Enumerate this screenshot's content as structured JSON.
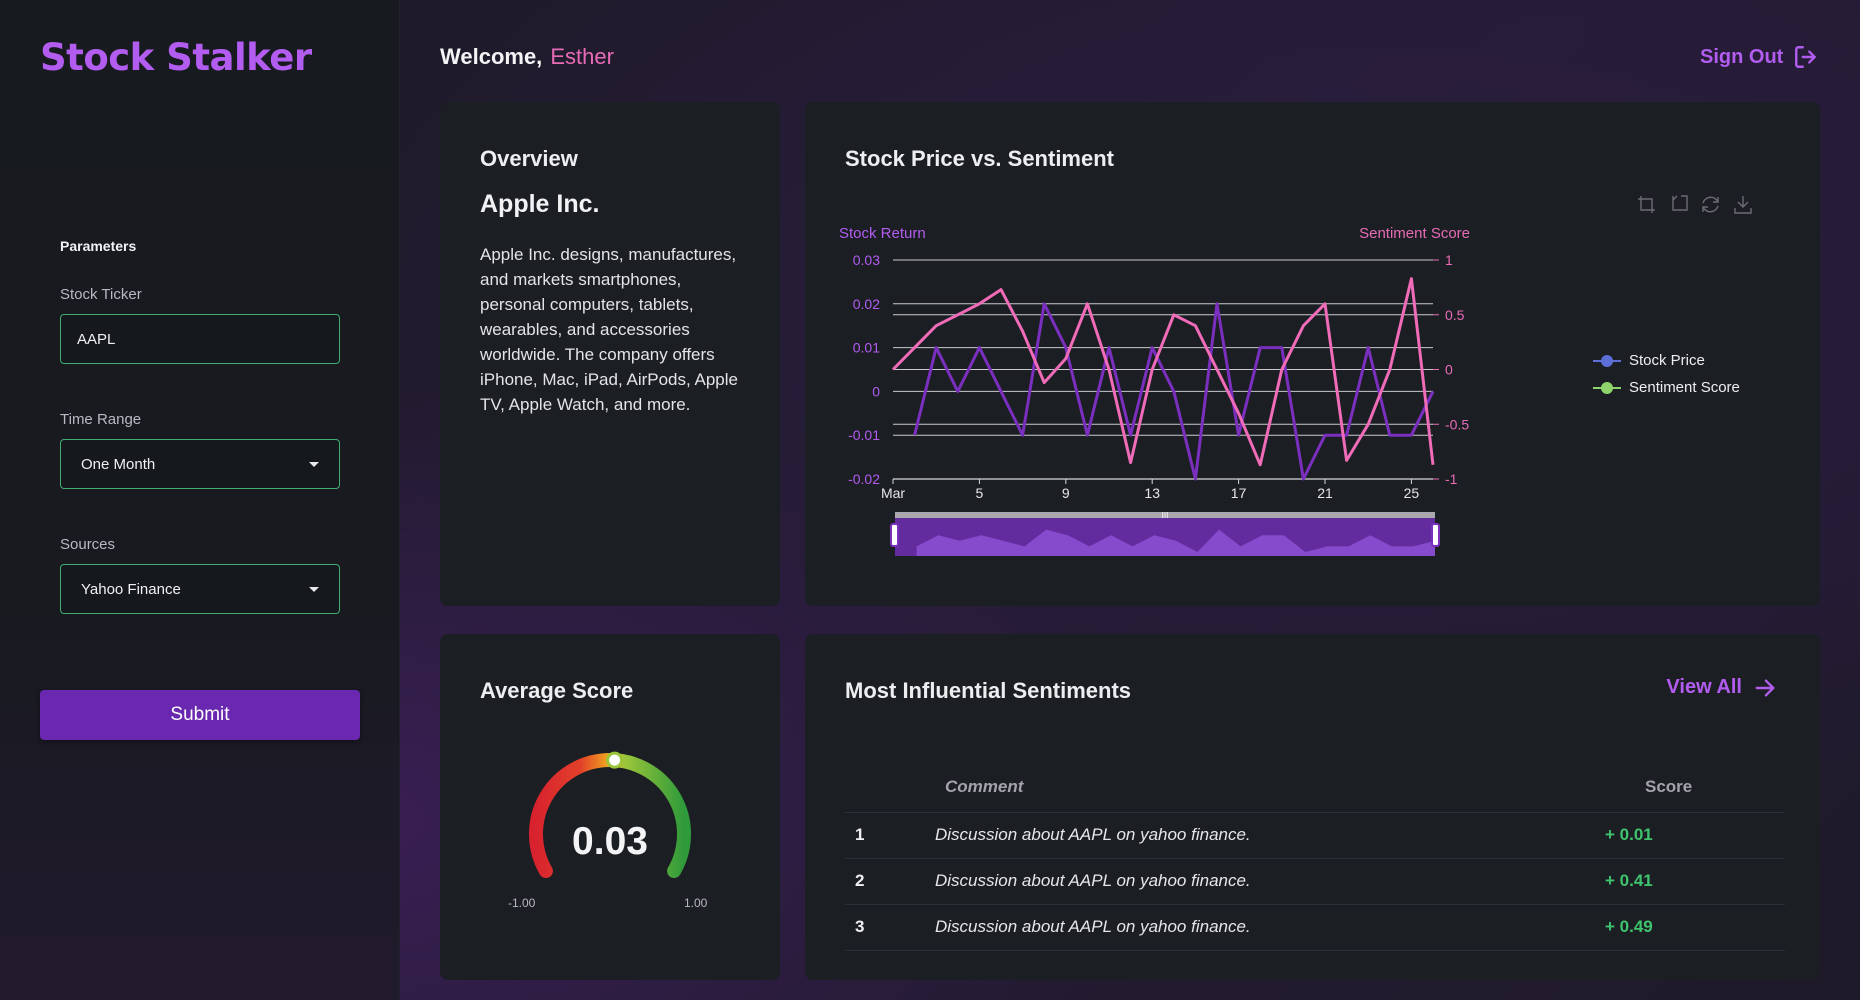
{
  "sidebar": {
    "brand": "Stock Stalker",
    "params_title": "Parameters",
    "ticker": {
      "label": "Stock Ticker",
      "value": "AAPL"
    },
    "time_range": {
      "label": "Time Range",
      "value": "One Month"
    },
    "sources": {
      "label": "Sources",
      "value": "Yahoo Finance"
    },
    "submit_label": "Submit"
  },
  "header": {
    "welcome": "Welcome,",
    "user_name": "Esther",
    "signout_label": "Sign Out"
  },
  "overview": {
    "title": "Overview",
    "company": "Apple Inc.",
    "description": "Apple Inc. designs, manufactures, and markets smartphones, personal computers, tablets, wearables, and accessories worldwide. The company offers iPhone, Mac, iPad, AirPods, Apple TV, Apple Watch, and more."
  },
  "chart_panel": {
    "title": "Stock Price vs. Sentiment"
  },
  "chart_data": {
    "type": "line",
    "ylabel_left": "Stock Return",
    "ylabel_right": "Sentiment Score",
    "ylim_left": [
      -0.02,
      0.03
    ],
    "ylim_right": [
      -1,
      1
    ],
    "yticks_left": [
      "0.03",
      "0.02",
      "0.01",
      "0",
      "-0.01",
      "-0.02"
    ],
    "yticks_right": [
      "1",
      "0.5",
      "0",
      "-0.5",
      "-1"
    ],
    "x_tick_labels": [
      "Mar",
      "5",
      "9",
      "13",
      "17",
      "21",
      "25"
    ],
    "x_tick_days": [
      1,
      5,
      9,
      13,
      17,
      21,
      25
    ],
    "x_range": [
      1,
      26
    ],
    "grid": true,
    "legend_position": "right",
    "series": [
      {
        "name": "Stock Price",
        "axis": "left",
        "color": "#7b2fbe",
        "legend_color": "#5b6fd6",
        "x": [
          2,
          3,
          4,
          5,
          6,
          7,
          8,
          9,
          10,
          11,
          12,
          13,
          14,
          15,
          16,
          17,
          18,
          19,
          20,
          21,
          22,
          23,
          24,
          25,
          26
        ],
        "values": [
          -0.01,
          0.01,
          0.0,
          0.01,
          0.0,
          -0.01,
          0.02,
          0.01,
          -0.01,
          0.01,
          -0.01,
          0.01,
          0.0,
          -0.02,
          0.02,
          -0.01,
          0.01,
          0.01,
          -0.02,
          -0.01,
          -0.01,
          0.01,
          -0.01,
          -0.01,
          0.0
        ]
      },
      {
        "name": "Sentiment Score",
        "axis": "right",
        "color": "#f06bb8",
        "legend_color": "#8fd46a",
        "x": [
          1,
          2,
          3,
          4,
          5,
          6,
          7,
          8,
          9,
          10,
          11,
          12,
          13,
          14,
          15,
          16,
          17,
          18,
          19,
          20,
          21,
          22,
          23,
          24,
          25,
          26
        ],
        "values": [
          0.0,
          0.2,
          0.4,
          0.5,
          0.6,
          0.73,
          0.35,
          -0.12,
          0.1,
          0.6,
          0.0,
          -0.85,
          0.0,
          0.5,
          0.4,
          0.0,
          -0.4,
          -0.87,
          0.0,
          0.4,
          0.6,
          -0.83,
          -0.5,
          0.0,
          0.83,
          -0.87
        ]
      }
    ],
    "zoom_range_label": "III"
  },
  "gauge": {
    "title": "Average Score",
    "value": "0.03",
    "min_label": "-1.00",
    "max_label": "1.00",
    "numeric_value": 0.03,
    "min": -1,
    "max": 1
  },
  "sentiments": {
    "title": "Most Influential Sentiments",
    "view_all_label": "View All",
    "headers": {
      "comment": "Comment",
      "score": "Score"
    },
    "rows": [
      {
        "num": "1",
        "comment": "Discussion about AAPL on yahoo finance.",
        "score": "+ 0.01"
      },
      {
        "num": "2",
        "comment": "Discussion about AAPL on yahoo finance.",
        "score": "+ 0.41"
      },
      {
        "num": "3",
        "comment": "Discussion about AAPL on yahoo finance.",
        "score": "+ 0.49"
      }
    ]
  },
  "colors": {
    "accent": "#b25cf0",
    "user_name": "#e86bb6",
    "field_border": "#3fae6f",
    "submit_bg": "#6a28b0",
    "score_positive": "#3fc46e"
  },
  "icons": {
    "signout": "sign-out-icon",
    "view_all": "arrow-right-icon",
    "caret": "chevron-down-icon",
    "toolbox": [
      "zoom-select-icon",
      "zoom-reset-icon",
      "restore-icon",
      "download-icon"
    ]
  }
}
